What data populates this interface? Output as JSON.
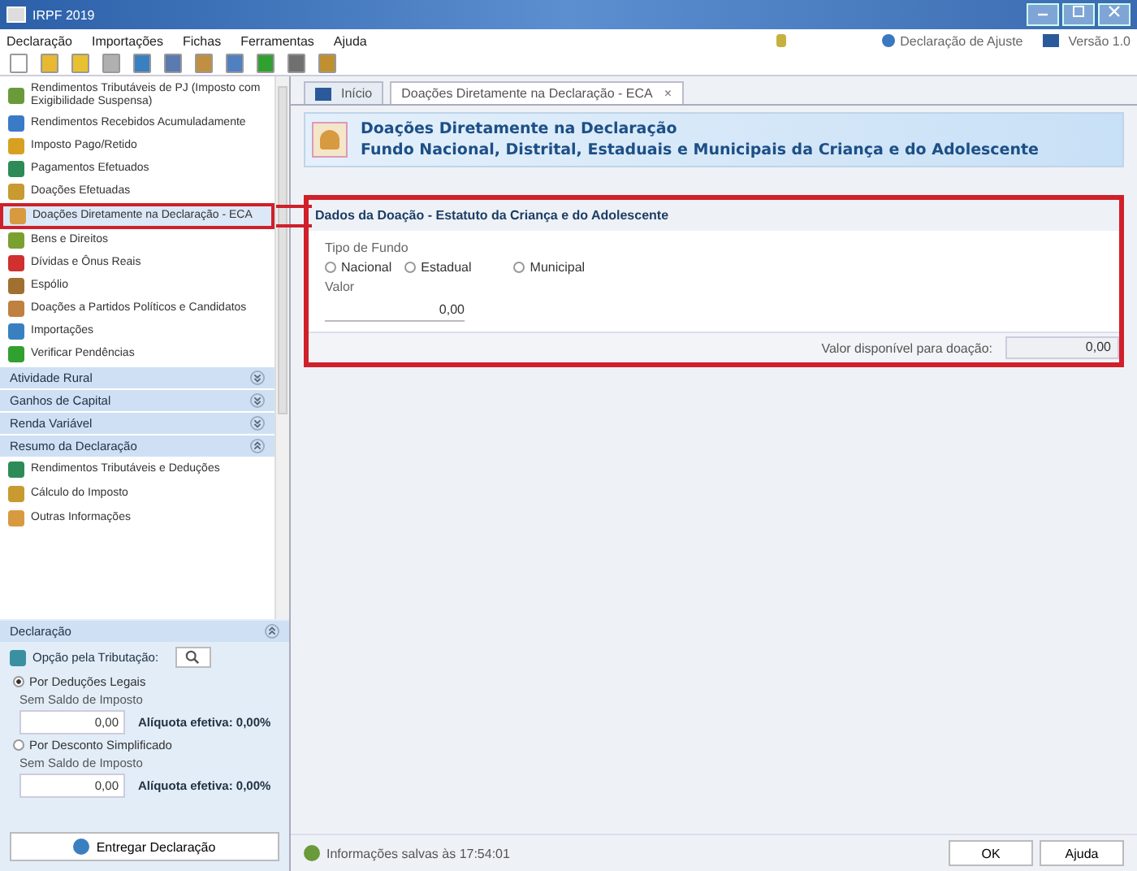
{
  "window": {
    "title": "IRPF 2019"
  },
  "menu": [
    "Declaração",
    "Importações",
    "Fichas",
    "Ferramentas",
    "Ajuda"
  ],
  "menu_right": [
    "Declaração de Ajuste",
    "Versão 1.0"
  ],
  "sidebar": {
    "items": [
      {
        "label": "Rendimentos Tributáveis de PJ (Imposto com Exigibilidade Suspensa)",
        "selected": false,
        "highlighted": false
      },
      {
        "label": "Rendimentos Recebidos Acumuladamente",
        "selected": false,
        "highlighted": false
      },
      {
        "label": "Imposto Pago/Retido",
        "selected": false,
        "highlighted": false
      },
      {
        "label": "Pagamentos Efetuados",
        "selected": false,
        "highlighted": false
      },
      {
        "label": "Doações Efetuadas",
        "selected": false,
        "highlighted": false
      },
      {
        "label": "Doações Diretamente na Declaração - ECA",
        "selected": true,
        "highlighted": true
      },
      {
        "label": "Bens e Direitos",
        "selected": false,
        "highlighted": false
      },
      {
        "label": "Dívidas e Ônus Reais",
        "selected": false,
        "highlighted": false
      },
      {
        "label": "Espólio",
        "selected": false,
        "highlighted": false
      },
      {
        "label": "Doações a Partidos Políticos e Candidatos",
        "selected": false,
        "highlighted": false
      },
      {
        "label": "Importações",
        "selected": false,
        "highlighted": false
      },
      {
        "label": "Verificar Pendências",
        "selected": false,
        "highlighted": false
      }
    ],
    "sections": [
      {
        "label": "Atividade Rural",
        "expanded": false
      },
      {
        "label": "Ganhos de Capital",
        "expanded": false
      },
      {
        "label": "Renda Variável",
        "expanded": false
      },
      {
        "label": "Resumo da Declaração",
        "expanded": true,
        "children": [
          {
            "label": "Rendimentos Tributáveis e Deduções"
          },
          {
            "label": "Cálculo do Imposto"
          },
          {
            "label": "Outras Informações"
          }
        ]
      }
    ]
  },
  "declaration_panel": {
    "title": "Declaração",
    "expanded": true,
    "option_label": "Opção pela Tributação:",
    "options": [
      {
        "label": "Por Deduções Legais",
        "selected": true,
        "sublabel": "Sem Saldo de Imposto",
        "value": "0,00",
        "rate": "Alíquota efetiva: 0,00%"
      },
      {
        "label": "Por Desconto Simplificado",
        "selected": false,
        "sublabel": "Sem Saldo de Imposto",
        "value": "0,00",
        "rate": "Alíquota efetiva: 0,00%"
      }
    ],
    "submit_button": "Entregar Declaração"
  },
  "tabs": [
    {
      "label": "Início",
      "selected": false
    },
    {
      "label": "Doações Diretamente na Declaração - ECA",
      "selected": true,
      "close": "×"
    }
  ],
  "banner": {
    "title_lines": [
      "Doações Diretamente na Declaração",
      "Fundo Nacional, Distrital, Estaduais e Municipais da Criança e do Adolescente"
    ]
  },
  "form": {
    "title": "Dados da Doação - Estatuto da Criança e do Adolescente",
    "highlighted": true,
    "fund_type_label": "Tipo de Fundo",
    "fund_options": [
      {
        "label": "Nacional",
        "selected": false
      },
      {
        "label": "Estadual",
        "selected": false
      },
      {
        "label": "Municipal",
        "selected": false
      }
    ],
    "value_label": "Valor",
    "value": "0,00",
    "available_label": "Valor disponível para doação:",
    "available_value": "0,00"
  },
  "status_bar": {
    "message": "Informações salvas às 17:54:01"
  },
  "buttons": [
    "OK",
    "Ajuda"
  ]
}
